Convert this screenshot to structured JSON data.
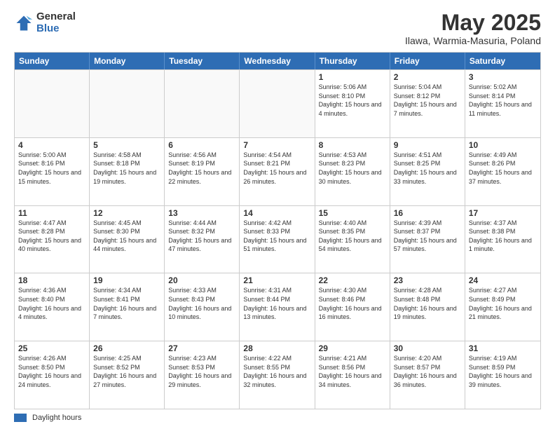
{
  "logo": {
    "general": "General",
    "blue": "Blue"
  },
  "title": {
    "month": "May 2025",
    "location": "Ilawa, Warmia-Masuria, Poland"
  },
  "days_of_week": [
    "Sunday",
    "Monday",
    "Tuesday",
    "Wednesday",
    "Thursday",
    "Friday",
    "Saturday"
  ],
  "footer": {
    "label": "Daylight hours"
  },
  "weeks": [
    [
      {
        "day": "",
        "info": ""
      },
      {
        "day": "",
        "info": ""
      },
      {
        "day": "",
        "info": ""
      },
      {
        "day": "",
        "info": ""
      },
      {
        "day": "1",
        "info": "Sunrise: 5:06 AM\nSunset: 8:10 PM\nDaylight: 15 hours\nand 4 minutes."
      },
      {
        "day": "2",
        "info": "Sunrise: 5:04 AM\nSunset: 8:12 PM\nDaylight: 15 hours\nand 7 minutes."
      },
      {
        "day": "3",
        "info": "Sunrise: 5:02 AM\nSunset: 8:14 PM\nDaylight: 15 hours\nand 11 minutes."
      }
    ],
    [
      {
        "day": "4",
        "info": "Sunrise: 5:00 AM\nSunset: 8:16 PM\nDaylight: 15 hours\nand 15 minutes."
      },
      {
        "day": "5",
        "info": "Sunrise: 4:58 AM\nSunset: 8:18 PM\nDaylight: 15 hours\nand 19 minutes."
      },
      {
        "day": "6",
        "info": "Sunrise: 4:56 AM\nSunset: 8:19 PM\nDaylight: 15 hours\nand 22 minutes."
      },
      {
        "day": "7",
        "info": "Sunrise: 4:54 AM\nSunset: 8:21 PM\nDaylight: 15 hours\nand 26 minutes."
      },
      {
        "day": "8",
        "info": "Sunrise: 4:53 AM\nSunset: 8:23 PM\nDaylight: 15 hours\nand 30 minutes."
      },
      {
        "day": "9",
        "info": "Sunrise: 4:51 AM\nSunset: 8:25 PM\nDaylight: 15 hours\nand 33 minutes."
      },
      {
        "day": "10",
        "info": "Sunrise: 4:49 AM\nSunset: 8:26 PM\nDaylight: 15 hours\nand 37 minutes."
      }
    ],
    [
      {
        "day": "11",
        "info": "Sunrise: 4:47 AM\nSunset: 8:28 PM\nDaylight: 15 hours\nand 40 minutes."
      },
      {
        "day": "12",
        "info": "Sunrise: 4:45 AM\nSunset: 8:30 PM\nDaylight: 15 hours\nand 44 minutes."
      },
      {
        "day": "13",
        "info": "Sunrise: 4:44 AM\nSunset: 8:32 PM\nDaylight: 15 hours\nand 47 minutes."
      },
      {
        "day": "14",
        "info": "Sunrise: 4:42 AM\nSunset: 8:33 PM\nDaylight: 15 hours\nand 51 minutes."
      },
      {
        "day": "15",
        "info": "Sunrise: 4:40 AM\nSunset: 8:35 PM\nDaylight: 15 hours\nand 54 minutes."
      },
      {
        "day": "16",
        "info": "Sunrise: 4:39 AM\nSunset: 8:37 PM\nDaylight: 15 hours\nand 57 minutes."
      },
      {
        "day": "17",
        "info": "Sunrise: 4:37 AM\nSunset: 8:38 PM\nDaylight: 16 hours\nand 1 minute."
      }
    ],
    [
      {
        "day": "18",
        "info": "Sunrise: 4:36 AM\nSunset: 8:40 PM\nDaylight: 16 hours\nand 4 minutes."
      },
      {
        "day": "19",
        "info": "Sunrise: 4:34 AM\nSunset: 8:41 PM\nDaylight: 16 hours\nand 7 minutes."
      },
      {
        "day": "20",
        "info": "Sunrise: 4:33 AM\nSunset: 8:43 PM\nDaylight: 16 hours\nand 10 minutes."
      },
      {
        "day": "21",
        "info": "Sunrise: 4:31 AM\nSunset: 8:44 PM\nDaylight: 16 hours\nand 13 minutes."
      },
      {
        "day": "22",
        "info": "Sunrise: 4:30 AM\nSunset: 8:46 PM\nDaylight: 16 hours\nand 16 minutes."
      },
      {
        "day": "23",
        "info": "Sunrise: 4:28 AM\nSunset: 8:48 PM\nDaylight: 16 hours\nand 19 minutes."
      },
      {
        "day": "24",
        "info": "Sunrise: 4:27 AM\nSunset: 8:49 PM\nDaylight: 16 hours\nand 21 minutes."
      }
    ],
    [
      {
        "day": "25",
        "info": "Sunrise: 4:26 AM\nSunset: 8:50 PM\nDaylight: 16 hours\nand 24 minutes."
      },
      {
        "day": "26",
        "info": "Sunrise: 4:25 AM\nSunset: 8:52 PM\nDaylight: 16 hours\nand 27 minutes."
      },
      {
        "day": "27",
        "info": "Sunrise: 4:23 AM\nSunset: 8:53 PM\nDaylight: 16 hours\nand 29 minutes."
      },
      {
        "day": "28",
        "info": "Sunrise: 4:22 AM\nSunset: 8:55 PM\nDaylight: 16 hours\nand 32 minutes."
      },
      {
        "day": "29",
        "info": "Sunrise: 4:21 AM\nSunset: 8:56 PM\nDaylight: 16 hours\nand 34 minutes."
      },
      {
        "day": "30",
        "info": "Sunrise: 4:20 AM\nSunset: 8:57 PM\nDaylight: 16 hours\nand 36 minutes."
      },
      {
        "day": "31",
        "info": "Sunrise: 4:19 AM\nSunset: 8:59 PM\nDaylight: 16 hours\nand 39 minutes."
      }
    ]
  ]
}
